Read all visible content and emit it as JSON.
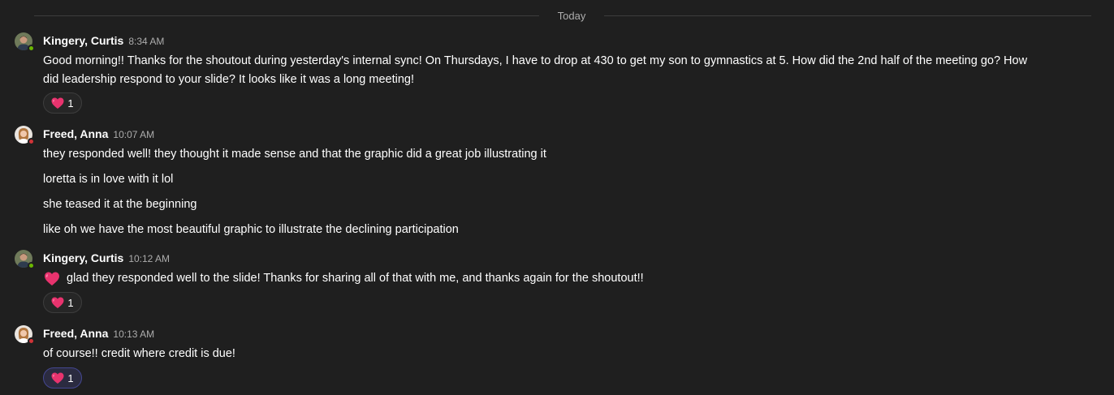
{
  "divider": {
    "label": "Today"
  },
  "messages": [
    {
      "author": "Kingery, Curtis",
      "time": "8:34 AM",
      "presence": "available",
      "lines": [
        "Good morning!! Thanks for the shoutout during yesterday's internal sync! On Thursdays, I have to drop at 430 to get my son to gymnastics at 5. How did the 2nd half of the meeting go? How",
        "did leadership respond to your slide? It looks like it was a long meeting!"
      ],
      "reaction": {
        "icon": "heart-icon",
        "count": "1"
      }
    },
    {
      "author": "Freed, Anna",
      "time": "10:07 AM",
      "presence": "busy",
      "lines": [
        "they responded well! they thought it made sense and that the graphic did a great job illustrating it",
        "loretta is in love with it lol",
        "she teased it at the beginning",
        "like oh we have the most beautiful graphic to illustrate the declining participation"
      ]
    },
    {
      "author": "Kingery, Curtis",
      "time": "10:12 AM",
      "presence": "available",
      "lines": [
        "glad they responded well to the slide! Thanks for sharing all of that with me, and thanks again for the shoutout!!"
      ],
      "reaction": {
        "icon": "heart-icon",
        "count": "1"
      }
    },
    {
      "author": "Freed, Anna",
      "time": "10:13 AM",
      "presence": "busy",
      "lines": [
        "of course!! credit where credit is due!"
      ],
      "reaction": {
        "icon": "heart-icon",
        "count": "1",
        "selected": true
      }
    }
  ],
  "colors": {
    "background": "#1f1f1f",
    "heart": "#e8336e",
    "available": "#6bb700",
    "busy": "#d13438",
    "selected_reaction_border": "#444791"
  }
}
